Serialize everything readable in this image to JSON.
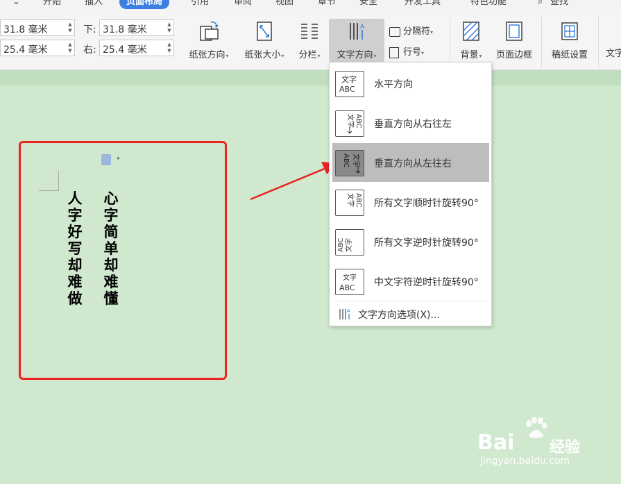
{
  "menubar": {
    "items": [
      {
        "label": "开始"
      },
      {
        "label": "插入"
      },
      {
        "label": "页面布局"
      },
      {
        "label": "引用"
      },
      {
        "label": "审阅"
      },
      {
        "label": "视图"
      },
      {
        "label": "章节"
      },
      {
        "label": "安全"
      },
      {
        "label": "开发工具"
      },
      {
        "label": "特色功能"
      },
      {
        "label": "查找"
      }
    ],
    "active_index": 2
  },
  "margins": {
    "top_value": "31.8 毫米",
    "left_value": "25.4 毫米",
    "bottom_label": "下:",
    "bottom_value": "31.8 毫米",
    "right_label": "右:",
    "right_value": "25.4 毫米"
  },
  "ribbon": {
    "orientation": "纸张方向",
    "size": "纸张大小",
    "columns": "分栏",
    "text_direction": "文字方向",
    "separator": "分隔符",
    "line_numbers": "行号",
    "background": "背景",
    "page_border": "页面边框",
    "grid_paper": "稿纸设置",
    "text_cut": "文字"
  },
  "document": {
    "column1": "人字好写却难做",
    "column2": "心字简单却难懂"
  },
  "dropdown": {
    "items": [
      {
        "label": "水平方向",
        "icon": "horizontal-text-icon"
      },
      {
        "label": "垂直方向从右往左",
        "icon": "vertical-rtl-icon"
      },
      {
        "label": "垂直方向从左往右",
        "icon": "vertical-ltr-icon"
      },
      {
        "label": "所有文字顺时针旋转90°",
        "icon": "rotate-cw-icon"
      },
      {
        "label": "所有文字逆时针旋转90°",
        "icon": "rotate-ccw-icon"
      },
      {
        "label": "中文字符逆时针旋转90°",
        "icon": "cjk-rotate-icon"
      }
    ],
    "selected_index": 2,
    "footer": "文字方向选项(X)..."
  },
  "watermark": {
    "brand": "Bai",
    "brand2": "经验",
    "url": "jingyan.baidu.com"
  },
  "colors": {
    "accent": "#3b7fe2",
    "highlight_border": "#ee2222",
    "page_bg": "#cfe8ce"
  }
}
